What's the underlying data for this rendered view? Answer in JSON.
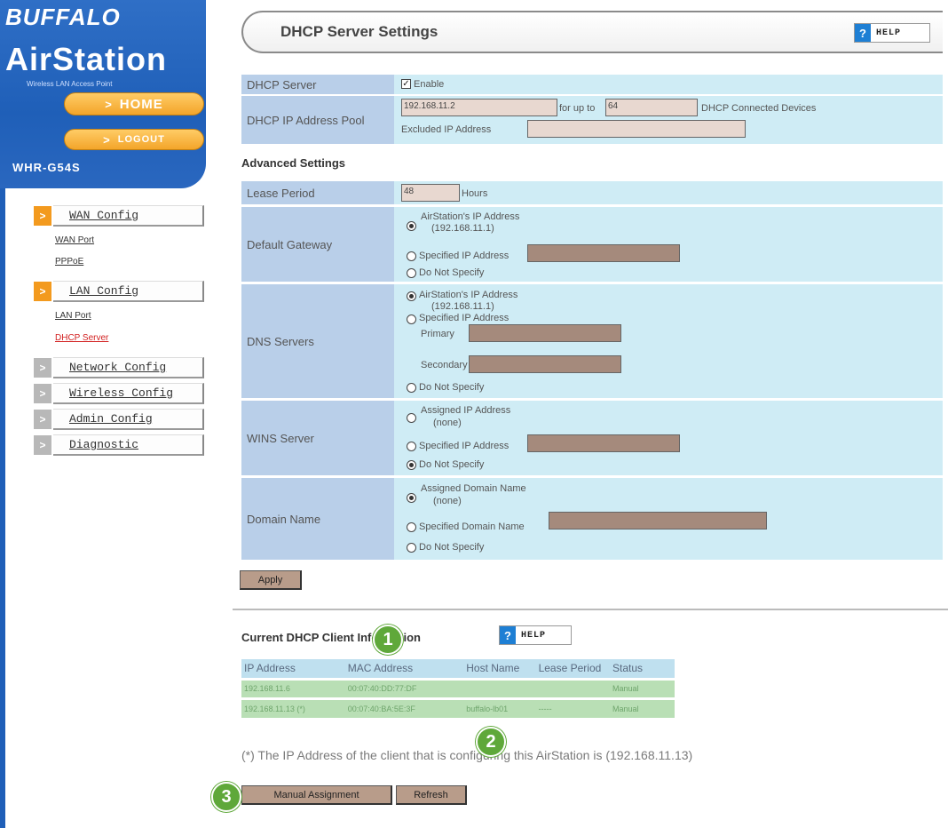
{
  "brand": {
    "name": "BUFFALO",
    "product": "AirStation",
    "subtitle": "Wireless LAN Access Point",
    "home_label": "HOME",
    "logout_label": "LOGOUT",
    "model": "WHR-G54S"
  },
  "sidebar": {
    "items": [
      {
        "label": "WAN Config",
        "subs": [
          "WAN Port",
          "PPPoE"
        ]
      },
      {
        "label": "LAN Config",
        "subs": [
          "LAN Port",
          "DHCP Server"
        ]
      },
      {
        "label": "Network Config"
      },
      {
        "label": "Wireless Config"
      },
      {
        "label": "Admin Config"
      },
      {
        "label": "Diagnostic"
      }
    ]
  },
  "header": {
    "title": "DHCP Server Settings",
    "help_label": "HELP"
  },
  "dhcp": {
    "server_label": "DHCP Server",
    "enable_label": "Enable",
    "pool_label": "DHCP IP Address Pool",
    "pool_start": "192.168.11.2",
    "for_up_to": "for up to",
    "pool_count": "64",
    "connected_devices": "DHCP Connected Devices",
    "excluded_label": "Excluded IP Address"
  },
  "advanced": {
    "title": "Advanced Settings",
    "lease_label": "Lease Period",
    "lease_value": "48",
    "lease_unit": "Hours",
    "gateway": {
      "label": "Default Gateway",
      "opt1": "AirStation's IP Address",
      "opt1_ip": "(192.168.11.1)",
      "opt2": "Specified IP Address",
      "opt3": "Do Not Specify"
    },
    "dns": {
      "label": "DNS Servers",
      "opt1": "AirStation's IP Address",
      "opt1_ip": "(192.168.11.1)",
      "opt2": "Specified IP Address",
      "primary": "Primary",
      "secondary": "Secondary",
      "opt3": "Do Not Specify"
    },
    "wins": {
      "label": "WINS Server",
      "opt1": "Assigned IP Address",
      "opt1_sub": "(none)",
      "opt2": "Specified IP Address",
      "opt3": "Do Not Specify"
    },
    "domain": {
      "label": "Domain Name",
      "opt1": "Assigned Domain Name",
      "opt1_sub": "(none)",
      "opt2": "Specified Domain Name",
      "opt3": "Do Not Specify"
    },
    "apply_label": "Apply"
  },
  "clients": {
    "title": "Current DHCP Client Information",
    "help_label": "HELP",
    "columns": [
      "IP Address",
      "MAC Address",
      "Host Name",
      "Lease Period",
      "Status"
    ],
    "rows": [
      [
        "192.168.11.6",
        "00:07:40:DD:77:DF",
        "",
        "",
        "Manual"
      ],
      [
        "192.168.11.13 (*)",
        "00:07:40:BA:5E:3F",
        "buffalo-lb01",
        "-----",
        "Manual"
      ]
    ],
    "note": "(*) The IP Address of the client that is configuring this AirStation is (192.168.11.13)",
    "manual_label": "Manual Assignment",
    "refresh_label": "Refresh"
  },
  "markers": [
    "1",
    "2",
    "3"
  ]
}
